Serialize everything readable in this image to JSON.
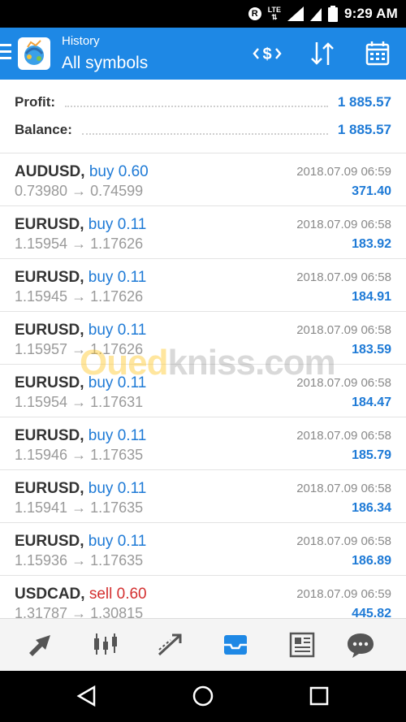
{
  "status_bar": {
    "time": "9:29",
    "ampm": "AM",
    "network": "LTE",
    "icons": [
      "r-badge-icon",
      "lte-signal-icon",
      "signal-icon",
      "battery-icon"
    ]
  },
  "header": {
    "subtitle": "History",
    "title": "All symbols",
    "icons": [
      "menu-icon",
      "app-logo",
      "currency-filter-icon",
      "sort-icon",
      "calendar-icon"
    ],
    "accent": "#1e88e5"
  },
  "summary": {
    "profit_label": "Profit:",
    "profit_value": "1 885.57",
    "balance_label": "Balance:",
    "balance_value": "1 885.57"
  },
  "trades": [
    {
      "symbol": "AUDUSD",
      "side": "buy",
      "lots": "0.60",
      "open": "0.73980",
      "close": "0.74599",
      "date": "2018.07.09 06:59",
      "profit": "371.40"
    },
    {
      "symbol": "EURUSD",
      "side": "buy",
      "lots": "0.11",
      "open": "1.15954",
      "close": "1.17626",
      "date": "2018.07.09 06:58",
      "profit": "183.92"
    },
    {
      "symbol": "EURUSD",
      "side": "buy",
      "lots": "0.11",
      "open": "1.15945",
      "close": "1.17626",
      "date": "2018.07.09 06:58",
      "profit": "184.91"
    },
    {
      "symbol": "EURUSD",
      "side": "buy",
      "lots": "0.11",
      "open": "1.15957",
      "close": "1.17626",
      "date": "2018.07.09 06:58",
      "profit": "183.59"
    },
    {
      "symbol": "EURUSD",
      "side": "buy",
      "lots": "0.11",
      "open": "1.15954",
      "close": "1.17631",
      "date": "2018.07.09 06:58",
      "profit": "184.47"
    },
    {
      "symbol": "EURUSD",
      "side": "buy",
      "lots": "0.11",
      "open": "1.15946",
      "close": "1.17635",
      "date": "2018.07.09 06:58",
      "profit": "185.79"
    },
    {
      "symbol": "EURUSD",
      "side": "buy",
      "lots": "0.11",
      "open": "1.15941",
      "close": "1.17635",
      "date": "2018.07.09 06:58",
      "profit": "186.34"
    },
    {
      "symbol": "EURUSD",
      "side": "buy",
      "lots": "0.11",
      "open": "1.15936",
      "close": "1.17635",
      "date": "2018.07.09 06:58",
      "profit": "186.89"
    },
    {
      "symbol": "USDCAD",
      "side": "sell",
      "lots": "0.60",
      "open": "1.31787",
      "close": "1.30815",
      "date": "2018.07.09 06:59",
      "profit": "445.82"
    }
  ],
  "watermark": {
    "first": "Oued",
    "rest": "kniss.com"
  },
  "bottom_nav": {
    "items": [
      "quotes-icon",
      "chart-icon",
      "trade-icon",
      "history-icon",
      "news-icon",
      "chat-icon"
    ],
    "active": "history-icon"
  },
  "system_nav": {
    "items": [
      "back-icon",
      "home-icon",
      "recents-icon"
    ]
  },
  "colors": {
    "profit_blue": "#1e7ad6",
    "sell_red": "#d32f2f",
    "muted_gray": "#9a9a9a"
  }
}
